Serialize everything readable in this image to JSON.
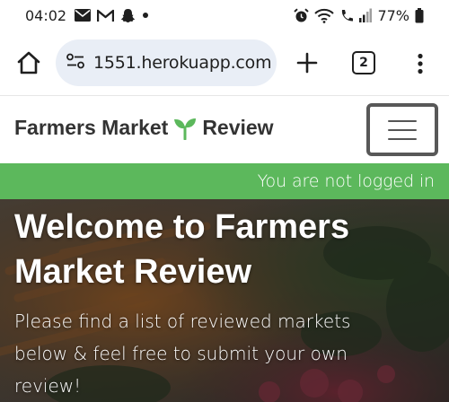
{
  "status_bar": {
    "time": "04:02",
    "battery": "77%",
    "left_icons": [
      "mail-icon",
      "gmail-icon",
      "snapchat-icon",
      "dot-icon"
    ],
    "right_icons": [
      "alarm-icon",
      "wifi-icon",
      "wifi-calling-icon",
      "signal-icon",
      "battery-icon"
    ]
  },
  "browser": {
    "url": "1551.herokuapp.com",
    "tab_count": "2"
  },
  "site": {
    "brand_part1": "Farmers Market",
    "brand_part2": "Review",
    "brand_color": "#333333",
    "sprout_color": "#5cb85c"
  },
  "login_bar": {
    "text": "You are not logged in",
    "color": "#5cb85c"
  },
  "hero": {
    "title": "Welcome to Farmers Market Review",
    "subtitle": "Please find a list of reviewed markets below & feel free to submit your own review!"
  }
}
